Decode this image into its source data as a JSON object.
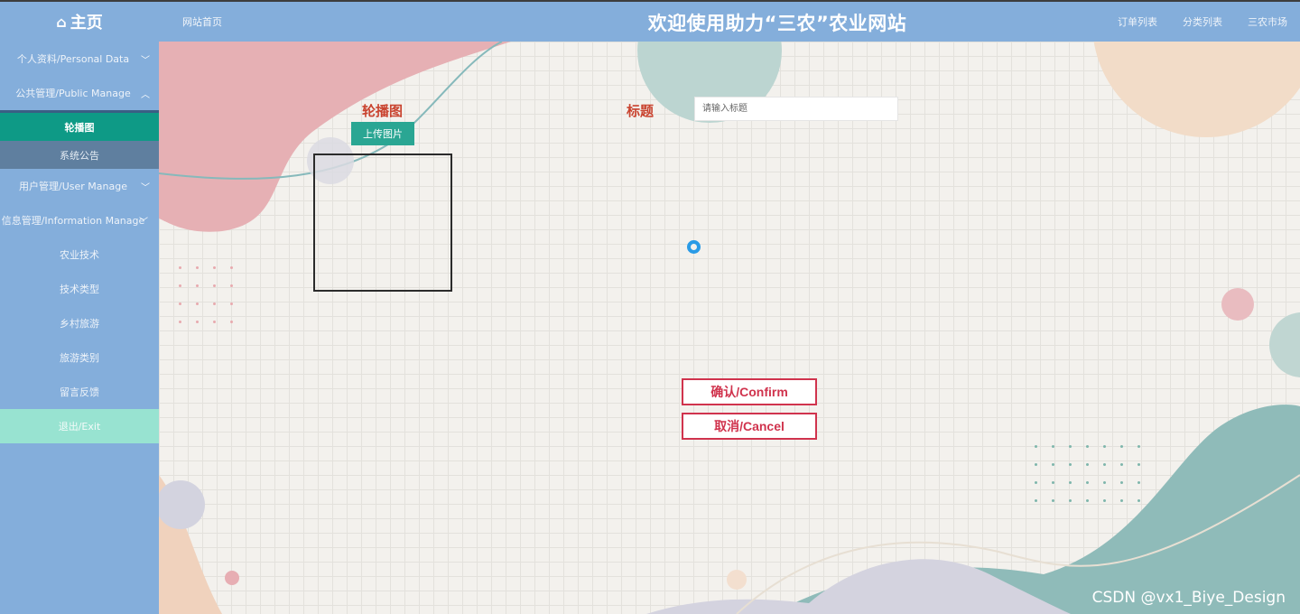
{
  "header": {
    "home_label": "主页",
    "site_home": "网站首页",
    "title": "欢迎使用助力“三农”农业网站",
    "links": [
      "订单列表",
      "分类列表",
      "三农市场"
    ]
  },
  "sidebar": {
    "items": [
      {
        "label": "个人资料/Personal Data",
        "chevron": "﹀"
      },
      {
        "label": "公共管理/Public Manage",
        "chevron": "︿"
      },
      {
        "label": "轮播图"
      },
      {
        "label": "系统公告"
      },
      {
        "label": "用户管理/User Manage",
        "chevron": "﹀"
      },
      {
        "label": "信息管理/Information Manage",
        "chevron": "﹀"
      },
      {
        "label": "农业技术"
      },
      {
        "label": "技术类型"
      },
      {
        "label": "乡村旅游"
      },
      {
        "label": "旅游类别"
      },
      {
        "label": "留言反馈"
      },
      {
        "label": "退出/Exit"
      }
    ]
  },
  "form": {
    "carousel_label": "轮播图",
    "upload_label": "上传图片",
    "title_label": "标题",
    "title_placeholder": "请输入标题",
    "title_value": "",
    "confirm_label": "确认/Confirm",
    "cancel_label": "取消/Cancel"
  },
  "watermark": "CSDN @vx1_Biye_Design",
  "colors": {
    "header_bg": "#84aedb",
    "active_item": "#0e9a86",
    "exit_item": "#98e3d1",
    "label_red": "#c9432f",
    "button_border": "#d0334d",
    "upload_btn": "#2aa693"
  }
}
